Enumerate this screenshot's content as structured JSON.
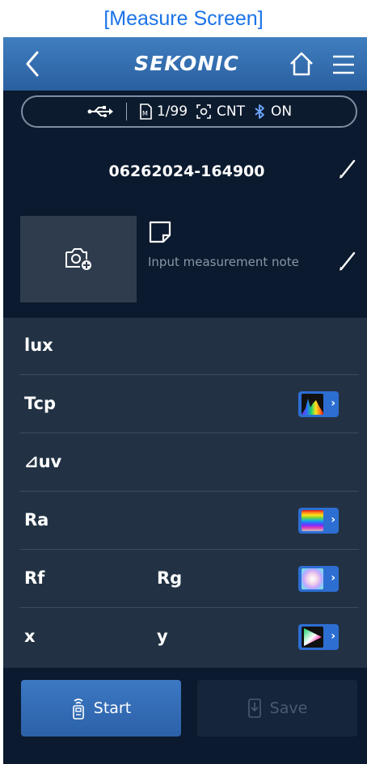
{
  "caption": "[Measure Screen]",
  "header": {
    "brand": "SEKONIC"
  },
  "status": {
    "memory": "1/99",
    "mode": "CNT",
    "bluetooth": "ON"
  },
  "file": {
    "name": "06262024-164900"
  },
  "note": {
    "placeholder": "Input measurement note"
  },
  "measurements": [
    {
      "label": "lux"
    },
    {
      "label": "Tcp",
      "graph": "spectrum-graph-icon"
    },
    {
      "label": "⊿uv"
    },
    {
      "label": "Ra",
      "graph": "color-rendering-bars-icon"
    },
    {
      "label": "Rf",
      "label2": "Rg",
      "graph": "color-vector-graph-icon"
    },
    {
      "label": "x",
      "label2": "y",
      "graph": "chromaticity-diagram-icon"
    }
  ],
  "actions": {
    "start": "Start",
    "save": "Save"
  },
  "colors": {
    "accent": "#2d6ed3",
    "background": "#0b1a2e",
    "panel": "#223244",
    "caption": "#1a73e8"
  }
}
